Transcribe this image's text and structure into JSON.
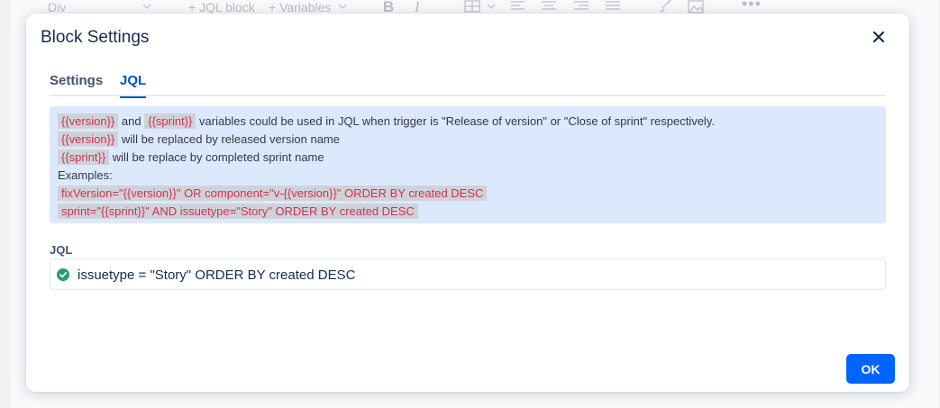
{
  "background_toolbar": {
    "block_type": "Div",
    "jql_block": "+ JQL block",
    "variables": "+ Variables"
  },
  "modal": {
    "title": "Block Settings",
    "tabs": [
      {
        "label": "Settings",
        "active": false
      },
      {
        "label": "JQL",
        "active": true
      }
    ],
    "info": {
      "line1": {
        "var_version": "{{version}}",
        "and": "and",
        "var_sprint": "{{sprint}}",
        "text": "variables could be used in JQL when trigger is \"Release of version\" or \"Close of sprint\" respectively."
      },
      "line2": {
        "var": "{{version}}",
        "text": "will be replaced by released version name"
      },
      "line3": {
        "var": "{{sprint}}",
        "text": "will be replace by completed sprint name"
      },
      "examples_label": "Examples:",
      "example1": "fixVersion=\"{{version}}\" OR component=\"v-{{version}}\" ORDER BY created DESC",
      "example2": "sprint=\"{{sprint}}\" AND issuetype=\"Story\" ORDER BY created DESC"
    },
    "jql": {
      "label": "JQL",
      "value": "issuetype = \"Story\" ORDER BY created DESC",
      "status_icon": "check-circle-icon",
      "status_color": "#22a06b"
    },
    "ok_label": "OK"
  },
  "colors": {
    "accent": "#0065ff",
    "tab_active": "#0052cc",
    "info_bg": "#dce8fb",
    "code_text": "#cc3355"
  }
}
